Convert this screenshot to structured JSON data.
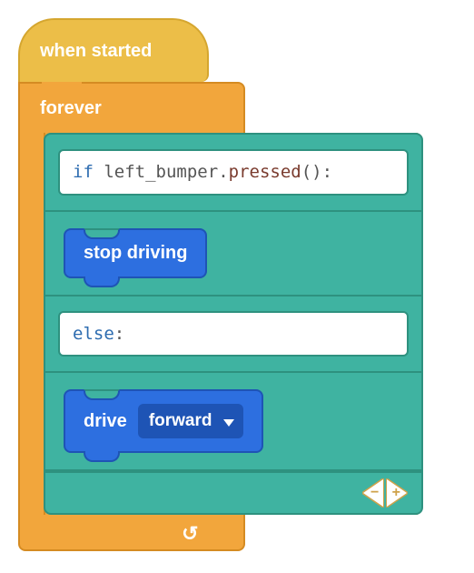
{
  "hat": {
    "label": "when started"
  },
  "forever": {
    "label": "forever"
  },
  "if_block": {
    "keyword": "if",
    "identifier": "left_bumper",
    "method": "pressed",
    "tail": "():"
  },
  "stop_block": {
    "label": "stop driving"
  },
  "else_block": {
    "keyword": "else",
    "tail": ":"
  },
  "drive_block": {
    "label": "drive",
    "dropdown_value": "forward"
  },
  "footer": {
    "minus": "−",
    "plus": "+"
  }
}
